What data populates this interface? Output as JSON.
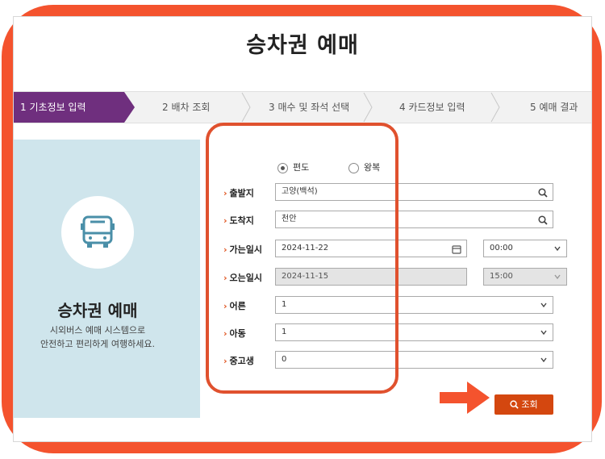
{
  "page": {
    "title": "승차권 예매"
  },
  "steps": [
    {
      "label": "1 기초정보 입력",
      "active": true
    },
    {
      "label": "2 배차 조회",
      "active": false
    },
    {
      "label": "3 매수 및 좌석 선택",
      "active": false
    },
    {
      "label": "4 카드정보 입력",
      "active": false
    },
    {
      "label": "5 예매 결과",
      "active": false
    }
  ],
  "left": {
    "icon": "bus-icon",
    "title": "승차권 예매",
    "desc_line1": "시외버스 예매 시스템으로",
    "desc_line2": "안전하고 편리하게 여행하세요."
  },
  "form": {
    "trip_type": {
      "one_way": "편도",
      "round_trip": "왕복",
      "selected": "편도"
    },
    "departure": {
      "label": "출발지",
      "value": "고양(백석)"
    },
    "arrival": {
      "label": "도착지",
      "value": "천안"
    },
    "go_date": {
      "label": "가는일시",
      "date": "2024-11-22",
      "time": "00:00"
    },
    "return_date": {
      "label": "오는일시",
      "date": "2024-11-15",
      "time": "15:00"
    },
    "adult": {
      "label": "어른",
      "value": "1"
    },
    "child": {
      "label": "아동",
      "value": "1"
    },
    "teen": {
      "label": "중고생",
      "value": "0"
    },
    "search_label": "조회"
  },
  "colors": {
    "accent": "#6f2f7e",
    "frame": "#f4532e",
    "button": "#d4470f",
    "panel": "#cfe5ec"
  }
}
